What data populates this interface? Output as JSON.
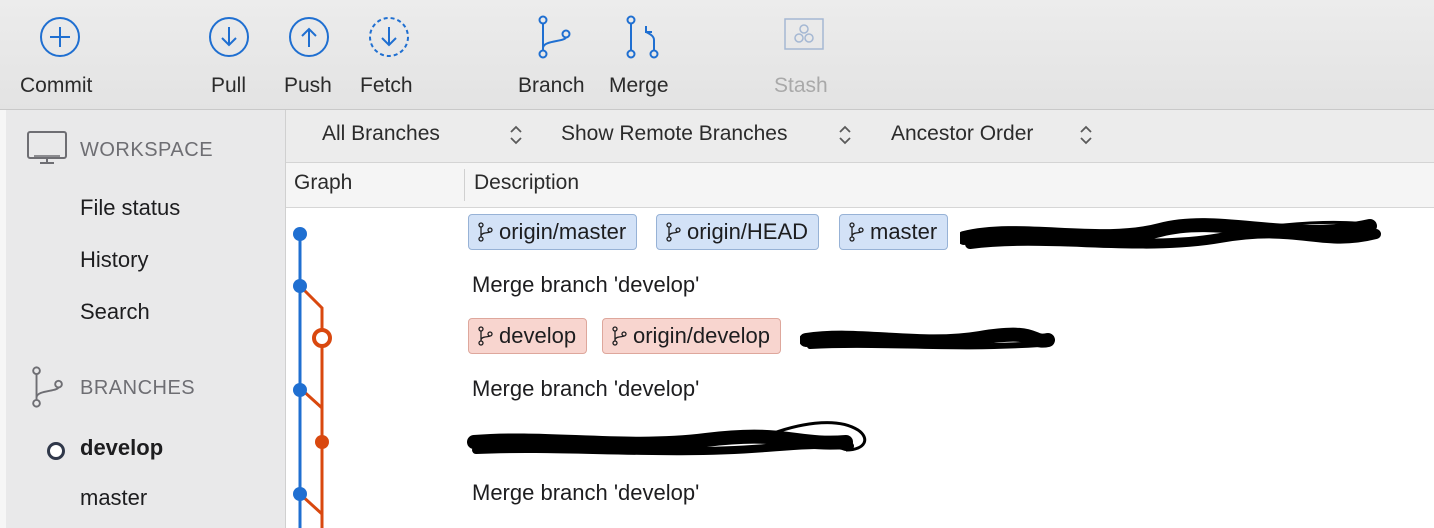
{
  "toolbar": {
    "commit": "Commit",
    "pull": "Pull",
    "push": "Push",
    "fetch": "Fetch",
    "branch": "Branch",
    "merge": "Merge",
    "stash": "Stash"
  },
  "sidebar": {
    "workspace": {
      "title": "WORKSPACE",
      "items": [
        "File status",
        "History",
        "Search"
      ]
    },
    "branches": {
      "title": "BRANCHES",
      "items": [
        {
          "label": "develop",
          "current": true
        },
        {
          "label": "master",
          "current": false
        }
      ]
    }
  },
  "filters": {
    "branches": "All Branches",
    "remote": "Show Remote Branches",
    "order": "Ancestor Order"
  },
  "columns": {
    "graph": "Graph",
    "description": "Description"
  },
  "commits": [
    {
      "tags": [
        "origin/master",
        "origin/HEAD",
        "master"
      ],
      "tag_color": "blue",
      "message": "",
      "redacted": true
    },
    {
      "tags": [],
      "message": "Merge branch 'develop'",
      "redacted": false
    },
    {
      "tags": [
        "develop",
        "origin/develop"
      ],
      "tag_color": "red",
      "message": "",
      "redacted": true
    },
    {
      "tags": [],
      "message": "Merge branch 'develop'",
      "redacted": false
    },
    {
      "tags": [],
      "message": "",
      "redacted": true
    },
    {
      "tags": [],
      "message": "Merge branch 'develop'",
      "redacted": false
    }
  ],
  "colors": {
    "accent": "#1f6fd1",
    "master_line": "#1f6fd1",
    "develop_line": "#d9480f",
    "blue_tag_bg": "#d3e2f7",
    "red_tag_bg": "#f8d5cf"
  }
}
